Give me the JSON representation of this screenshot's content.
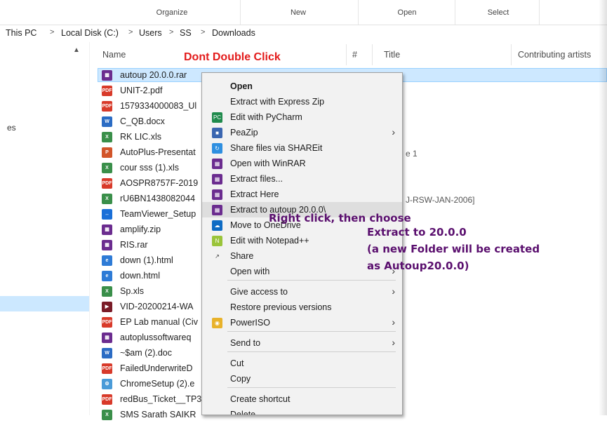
{
  "ribbon": {
    "groups": [
      "Organize",
      "New",
      "Open",
      "Select"
    ]
  },
  "address": {
    "crumbs": [
      "This PC",
      "Local Disk (C:)",
      "Users",
      "SS",
      "Downloads"
    ],
    "sep": ">"
  },
  "nav": {
    "fragment": "es"
  },
  "columns": {
    "name": "Name",
    "num": "#",
    "title": "Title",
    "artists": "Contributing artists"
  },
  "annotation_top": "Dont Double Click",
  "files": [
    {
      "name": "autoup 20.0.0.rar",
      "icon": "winrar-icon"
    },
    {
      "name": "UNIT-2.pdf",
      "icon": "pdf-icon"
    },
    {
      "name": "1579334000083_Ul",
      "icon": "pdf-icon"
    },
    {
      "name": "C_QB.docx",
      "icon": "word-icon"
    },
    {
      "name": "RK LIC.xls",
      "icon": "excel-icon"
    },
    {
      "name": "AutoPlus-Presentat",
      "icon": "powerpoint-icon"
    },
    {
      "name": "cour sss (1).xls",
      "icon": "excel-icon"
    },
    {
      "name": "AOSPR8757F-2019",
      "icon": "pdf-icon"
    },
    {
      "name": "rU6BN1438082044",
      "icon": "excel-icon"
    },
    {
      "name": "TeamViewer_Setup",
      "icon": "teamviewer-icon"
    },
    {
      "name": "amplify.zip",
      "icon": "winrar-icon"
    },
    {
      "name": "RIS.rar",
      "icon": "winrar-icon"
    },
    {
      "name": "down (1).html",
      "icon": "edge-icon"
    },
    {
      "name": "down.html",
      "icon": "edge-icon"
    },
    {
      "name": "Sp.xls",
      "icon": "excel-icon"
    },
    {
      "name": "VID-20200214-WA",
      "icon": "video-icon"
    },
    {
      "name": "EP Lab manual (Civ",
      "icon": "pdf-icon"
    },
    {
      "name": "autoplussoftwareq",
      "icon": "winrar-icon"
    },
    {
      "name": "~$am (2).doc",
      "icon": "word-icon"
    },
    {
      "name": "FailedUnderwriteD",
      "icon": "pdf-icon"
    },
    {
      "name": "ChromeSetup (2).e",
      "icon": "setup-icon"
    },
    {
      "name": "redBus_Ticket__TP3",
      "icon": "pdf-icon"
    },
    {
      "name": "SMS Sarath  SAIKR",
      "icon": "excel-icon"
    }
  ],
  "extra_cells": {
    "title_1": "e 1",
    "title_2": "J-RSW-JAN-2006]"
  },
  "menu": [
    {
      "label": "Open",
      "bold": true
    },
    {
      "label": "Extract with Express Zip"
    },
    {
      "label": "Edit with PyCharm",
      "icon": "pycharm-icon"
    },
    {
      "label": "PeaZip",
      "icon": "peazip-icon",
      "arrow": true
    },
    {
      "label": "Share files via SHAREit",
      "icon": "shareit-icon"
    },
    {
      "label": "Open with WinRAR",
      "icon": "winrar-icon"
    },
    {
      "label": "Extract files...",
      "icon": "winrar-icon"
    },
    {
      "label": "Extract Here",
      "icon": "winrar-icon"
    },
    {
      "label": "Extract to autoup 20.0.0\\",
      "icon": "winrar-icon",
      "highlight": true
    },
    {
      "label": "Move to OneDrive",
      "icon": "onedrive-icon"
    },
    {
      "label": "Edit with Notepad++",
      "icon": "notepadpp-icon"
    },
    {
      "label": "Share",
      "icon": "share-icon"
    },
    {
      "label": "Open with",
      "arrow": true
    },
    {
      "label": "Give access to",
      "arrow": true
    },
    {
      "label": "Restore previous versions"
    },
    {
      "label": "PowerISO",
      "icon": "poweriso-icon",
      "arrow": true
    },
    {
      "label": "Send to",
      "arrow": true
    },
    {
      "label": "Cut"
    },
    {
      "label": "Copy"
    },
    {
      "label": "Create shortcut"
    },
    {
      "label": "Delete"
    }
  ],
  "annotation": {
    "line1": "Right click, then choose",
    "line2": "Extract to 20.0.0",
    "line3": "(a new Folder will be created",
    "line4": "as Autoup20.0.0)"
  }
}
